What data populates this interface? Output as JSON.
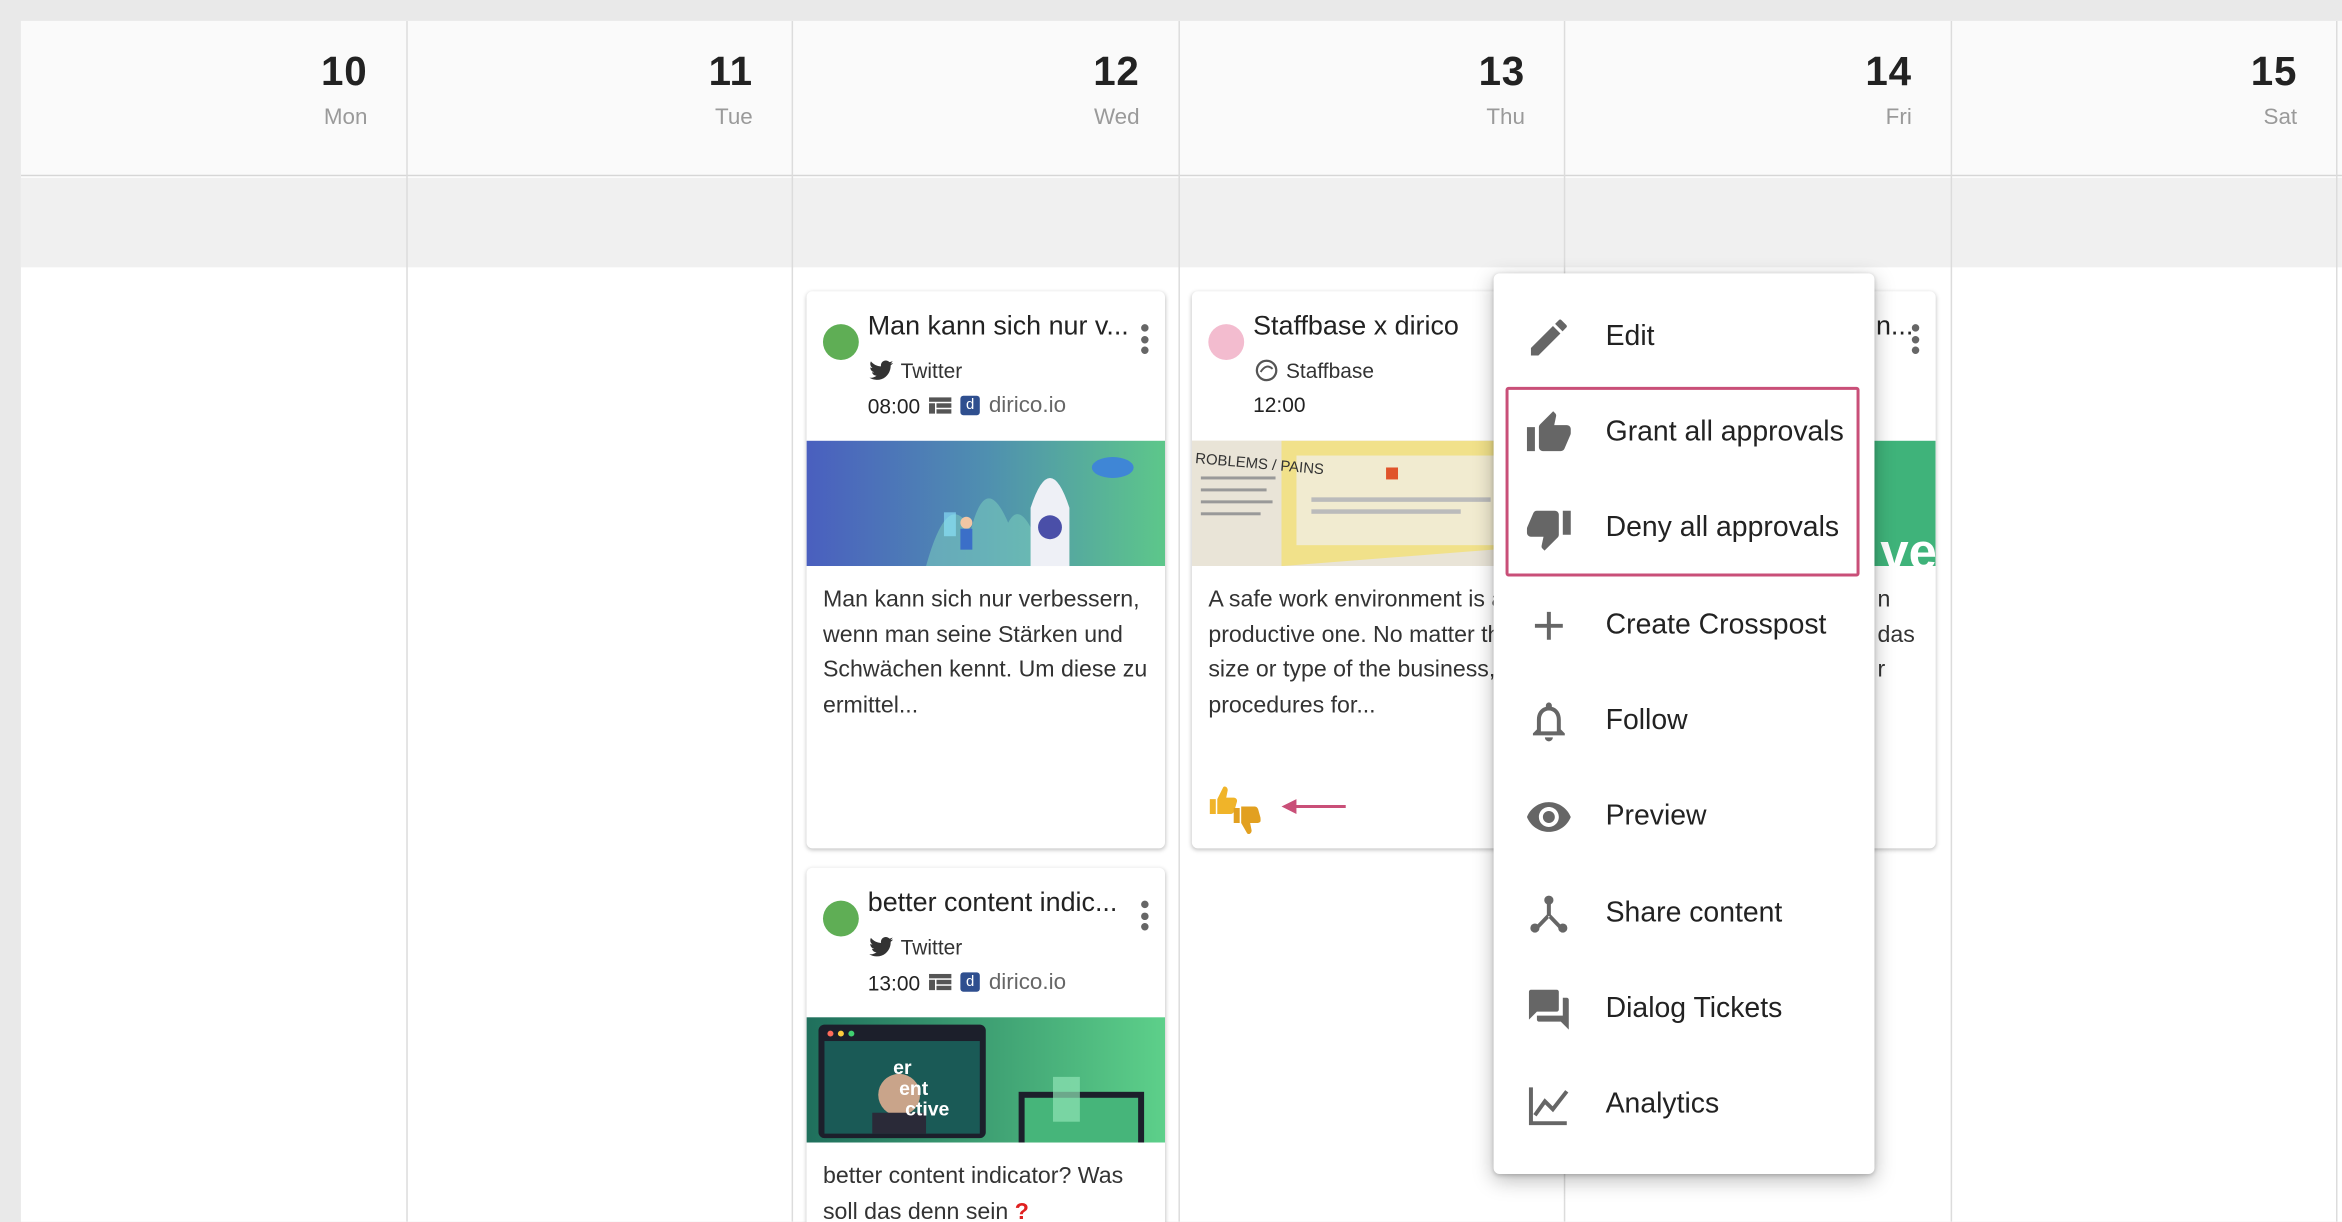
{
  "days": [
    {
      "num": "10",
      "name": "Mon"
    },
    {
      "num": "11",
      "name": "Tue"
    },
    {
      "num": "12",
      "name": "Wed"
    },
    {
      "num": "13",
      "name": "Thu"
    },
    {
      "num": "14",
      "name": "Fri"
    },
    {
      "num": "15",
      "name": "Sat"
    }
  ],
  "cards": [
    {
      "title": "Man kann sich nur v...",
      "network": "Twitter",
      "time": "08:00",
      "account": "dirico.io",
      "text": "Man kann sich nur verbessern, wenn man seine Stärken und Schwächen kennt. Um diese zu ermittel...",
      "status_color": "#5fae55"
    },
    {
      "title": "Staffbase x dirico",
      "network": "Staffbase",
      "time": "12:00",
      "text": "A safe work environment is a productive one. No matter the size or type of the business, procedures for...",
      "status_color": "#f3bccf"
    },
    {
      "title": "better content indic...",
      "network": "Twitter",
      "time": "13:00",
      "account": "dirico.io",
      "text": "better content indicator? Was soll das denn sein",
      "status_color": "#5fae55"
    },
    {
      "title_tail": "n...",
      "text_tail": [
        "n",
        "das",
        "r"
      ]
    }
  ],
  "thumb_texts": {
    "problems": "ROBLEMS / PAINS",
    "video": "er\nent\nctive",
    "fri_letters": "ve"
  },
  "menu": {
    "items": [
      {
        "label": "Edit",
        "icon": "pencil-icon"
      },
      {
        "label": "Grant all approvals",
        "icon": "thumb-up-icon"
      },
      {
        "label": "Deny all approvals",
        "icon": "thumb-down-icon"
      },
      {
        "label": "Create Crosspost",
        "icon": "plus-icon"
      },
      {
        "label": "Follow",
        "icon": "bell-icon"
      },
      {
        "label": "Preview",
        "icon": "eye-icon"
      },
      {
        "label": "Share content",
        "icon": "share-icon"
      },
      {
        "label": "Dialog Tickets",
        "icon": "forum-icon"
      },
      {
        "label": "Analytics",
        "icon": "chart-line-icon"
      }
    ]
  },
  "colors": {
    "highlight": "#c94f78",
    "arrow": "#c94f78",
    "approval_yellow": "#f0b429"
  }
}
